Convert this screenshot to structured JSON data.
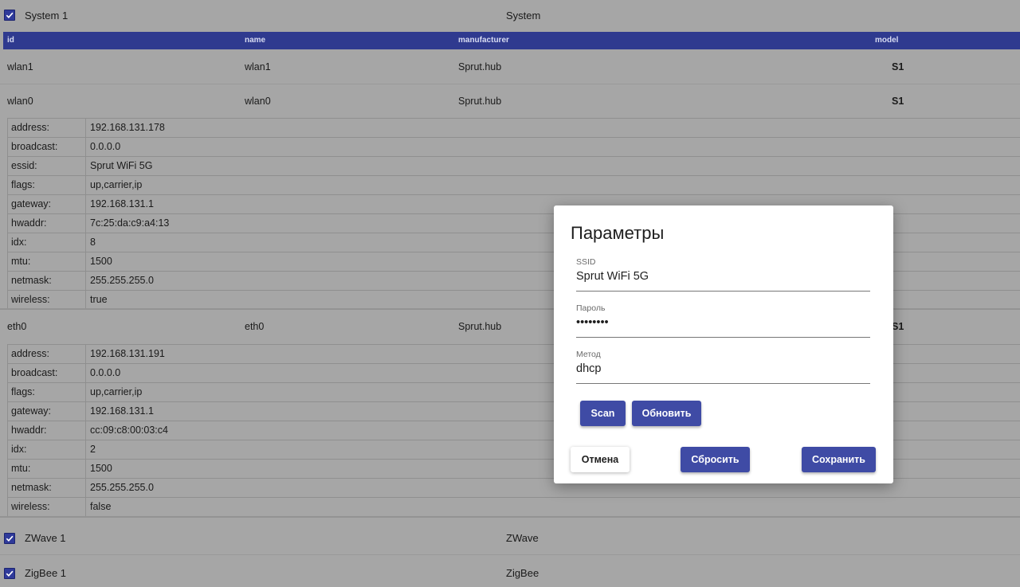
{
  "system": {
    "label": "System 1",
    "type": "System",
    "checked": true
  },
  "columns": {
    "id": "id",
    "name": "name",
    "manufacturer": "manufacturer",
    "model": "model"
  },
  "devices": [
    {
      "id": "wlan1",
      "name": "wlan1",
      "manufacturer": "Sprut.hub",
      "model": "S1"
    },
    {
      "id": "wlan0",
      "name": "wlan0",
      "manufacturer": "Sprut.hub",
      "model": "S1"
    },
    {
      "id": "eth0",
      "name": "eth0",
      "manufacturer": "Sprut.hub",
      "model": "S1"
    }
  ],
  "wlan0_props": [
    {
      "k": "address:",
      "v": "192.168.131.178"
    },
    {
      "k": "broadcast:",
      "v": "0.0.0.0"
    },
    {
      "k": "essid:",
      "v": "Sprut WiFi 5G"
    },
    {
      "k": "flags:",
      "v": "up,carrier,ip"
    },
    {
      "k": "gateway:",
      "v": "192.168.131.1"
    },
    {
      "k": "hwaddr:",
      "v": "7c:25:da:c9:a4:13"
    },
    {
      "k": "idx:",
      "v": "8"
    },
    {
      "k": "mtu:",
      "v": "1500"
    },
    {
      "k": "netmask:",
      "v": "255.255.255.0"
    },
    {
      "k": "wireless:",
      "v": "true"
    }
  ],
  "eth0_props": [
    {
      "k": "address:",
      "v": "192.168.131.191"
    },
    {
      "k": "broadcast:",
      "v": "0.0.0.0"
    },
    {
      "k": "flags:",
      "v": "up,carrier,ip"
    },
    {
      "k": "gateway:",
      "v": "192.168.131.1"
    },
    {
      "k": "hwaddr:",
      "v": "cc:09:c8:00:03:c4"
    },
    {
      "k": "idx:",
      "v": "2"
    },
    {
      "k": "mtu:",
      "v": "1500"
    },
    {
      "k": "netmask:",
      "v": "255.255.255.0"
    },
    {
      "k": "wireless:",
      "v": "false"
    }
  ],
  "zwave": {
    "label": "ZWave 1",
    "type": "ZWave",
    "checked": true
  },
  "zigbee": {
    "label": "ZigBee 1",
    "type": "ZigBee",
    "checked": true
  },
  "dialog": {
    "title": "Параметры",
    "ssid_label": "SSID",
    "ssid_value": "Sprut WiFi 5G",
    "password_label": "Пароль",
    "password_value": "••••••••",
    "method_label": "Метод",
    "method_value": "dhcp",
    "scan_label": "Scan",
    "refresh_label": "Обновить",
    "cancel_label": "Отмена",
    "reset_label": "Сбросить",
    "save_label": "Сохранить"
  },
  "colors": {
    "accent": "#3f4ba5",
    "header_bg": "#2f3a8f",
    "page_bg": "#a6a6a6"
  },
  "icons": {
    "checkbox": "checkbox-checked-icon"
  }
}
